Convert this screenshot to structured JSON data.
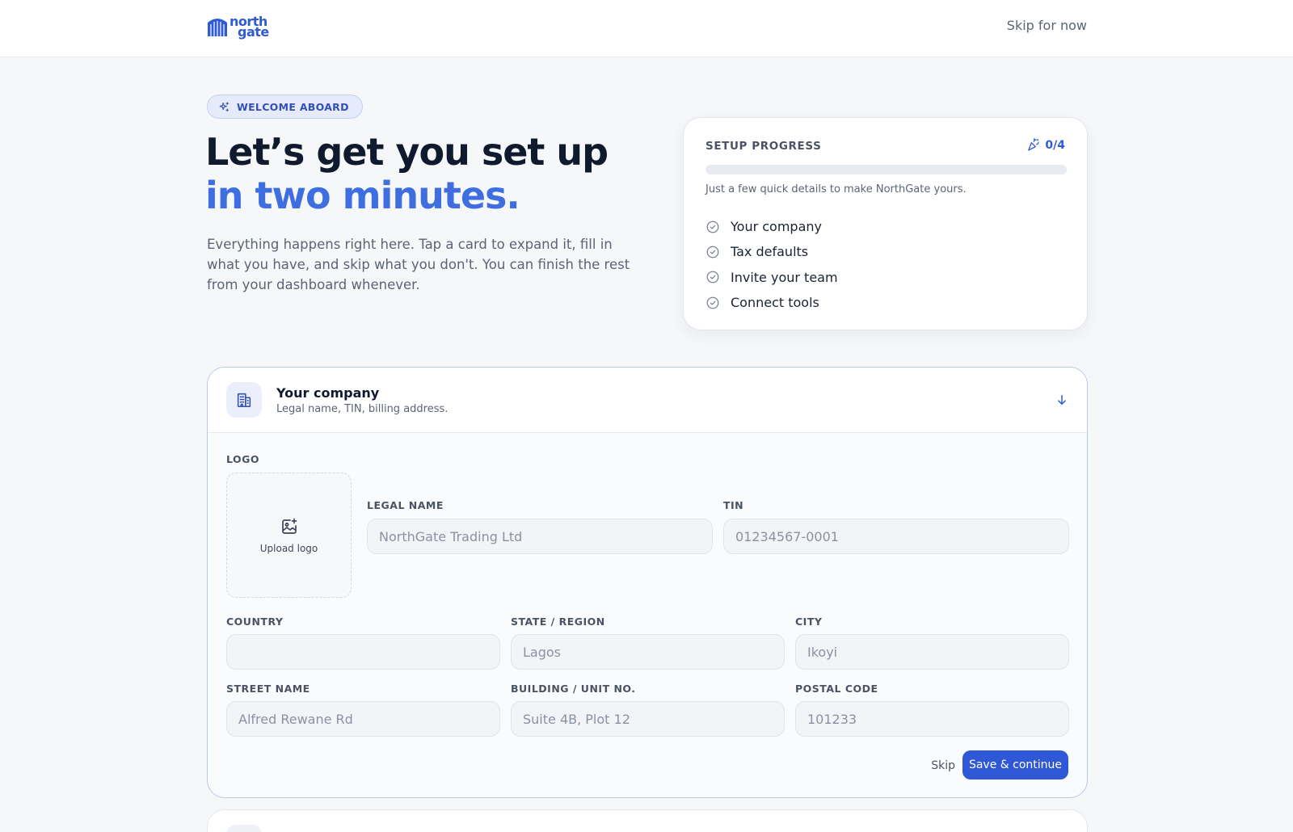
{
  "header": {
    "logo_top": "north",
    "logo_bottom": "gate",
    "skip_label": "Skip for now"
  },
  "hero": {
    "badge": "WELCOME ABOARD",
    "title_line1": "Let’s get you set up",
    "title_line2": "in two minutes.",
    "description": "Everything happens right here. Tap a card to expand it, fill in what you have, and skip what you don't. You can finish the rest from your dashboard whenever."
  },
  "progress": {
    "title": "SETUP PROGRESS",
    "count": "0/4",
    "completed_fraction": 0,
    "subtitle": "Just a few quick details to make NorthGate yours.",
    "steps": [
      "Your company",
      "Tax defaults",
      "Invite your team",
      "Connect tools"
    ]
  },
  "company": {
    "title": "Your company",
    "subtitle": "Legal name, TIN, billing address.",
    "logo_label": "LOGO",
    "upload_label": "Upload logo",
    "fields": {
      "legal_name": {
        "label": "LEGAL NAME",
        "value": "",
        "placeholder": "NorthGate Trading Ltd"
      },
      "tin": {
        "label": "TIN",
        "value": "",
        "placeholder": "01234567-0001"
      },
      "country": {
        "label": "COUNTRY",
        "value": "",
        "placeholder": ""
      },
      "state": {
        "label": "STATE / REGION",
        "value": "",
        "placeholder": "Lagos"
      },
      "city": {
        "label": "CITY",
        "value": "",
        "placeholder": "Ikoyi"
      },
      "street": {
        "label": "STREET NAME",
        "value": "",
        "placeholder": "Alfred Rewane Rd"
      },
      "building": {
        "label": "BUILDING / UNIT NO.",
        "value": "",
        "placeholder": "Suite 4B, Plot 12"
      },
      "postal": {
        "label": "POSTAL CODE",
        "value": "",
        "placeholder": "101233"
      }
    },
    "skip_label": "Skip",
    "save_label": "Save & continue"
  },
  "colors": {
    "accent": "#3f6ee0",
    "primary_button": "#2f58d6",
    "page_bg": "#f6f7f9"
  },
  "icons": {
    "badge": "sparkles-icon",
    "progress_count": "party-popper-icon",
    "step": "check-circle-icon",
    "company": "building-icon",
    "collapse": "arrow-down-icon",
    "upload": "image-plus-icon"
  }
}
